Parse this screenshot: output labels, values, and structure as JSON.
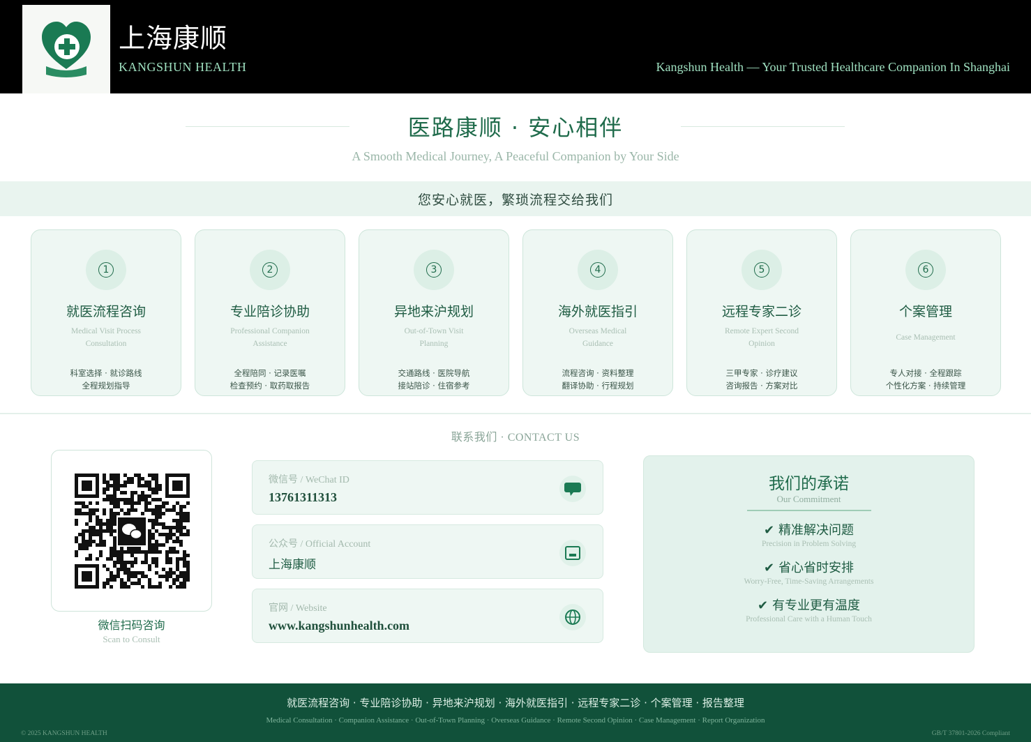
{
  "header": {
    "brand_cn": "上海康顺",
    "brand_en": "KANGSHUN HEALTH",
    "tagline": "Kangshun Health — Your Trusted Healthcare Companion In Shanghai"
  },
  "hero": {
    "title": "医路康顺 · 安心相伴",
    "subtitle": "A Smooth Medical Journey, A Peaceful Companion by Your Side"
  },
  "banner": "您安心就医，繁琐流程交给我们",
  "services": [
    {
      "num": "1",
      "title": "就医流程咨询",
      "en_1": "Medical Visit Process",
      "en_2": "Consultation",
      "desc_1": "科室选择 · 就诊路线",
      "desc_2": "全程规划指导"
    },
    {
      "num": "2",
      "title": "专业陪诊协助",
      "en_1": "Professional Companion",
      "en_2": "Assistance",
      "desc_1": "全程陪同 · 记录医嘱",
      "desc_2": "检查预约 · 取药取报告"
    },
    {
      "num": "3",
      "title": "异地来沪规划",
      "en_1": "Out-of-Town Visit",
      "en_2": "Planning",
      "desc_1": "交通路线 · 医院导航",
      "desc_2": "接站陪诊 · 住宿参考"
    },
    {
      "num": "4",
      "title": "海外就医指引",
      "en_1": "Overseas Medical",
      "en_2": "Guidance",
      "desc_1": "流程咨询 · 资料整理",
      "desc_2": "翻译协助 · 行程规划"
    },
    {
      "num": "5",
      "title": "远程专家二诊",
      "en_1": "Remote Expert Second",
      "en_2": "Opinion",
      "desc_1": "三甲专家 · 诊疗建议",
      "desc_2": "咨询报告 · 方案对比"
    },
    {
      "num": "6",
      "title": "个案管理",
      "en_1": "Case Management",
      "en_2": "",
      "desc_1": "专人对接 · 全程跟踪",
      "desc_2": "个性化方案 · 持续管理"
    }
  ],
  "contact": {
    "title": "联系我们 · CONTACT US",
    "qr_label": "微信扫码咨询",
    "qr_sub": "Scan to Consult",
    "wechat_label": "微信号 / WeChat ID",
    "wechat_value": "13761311313",
    "account_label": "公众号 / Official Account",
    "account_value": "上海康顺",
    "website_label": "官网 / Website",
    "website_value": "www.kangshunhealth.com"
  },
  "commitment": {
    "title": "我们的承诺",
    "subtitle": "Our Commitment",
    "items": [
      {
        "check": "✔",
        "cn": "精准解决问题",
        "en": "Precision in Problem Solving"
      },
      {
        "check": "✔",
        "cn": "省心省时安排",
        "en": "Worry-Free, Time-Saving Arrangements"
      },
      {
        "check": "✔",
        "cn": "有专业更有温度",
        "en": "Professional Care with a Human Touch"
      }
    ]
  },
  "footer": {
    "services_cn": "就医流程咨询 · 专业陪诊协助 · 异地来沪规划 · 海外就医指引 · 远程专家二诊 · 个案管理 · 报告整理",
    "services_en": "Medical Consultation · Companion Assistance · Out-of-Town Planning · Overseas Guidance · Remote Second Opinion · Case Management · Report Organization",
    "copyright": "© 2025 KANGSHUN HEALTH",
    "standard": "GB/T 37801-2026 Compliant"
  },
  "colors": {
    "primary": "#1f6b4b",
    "footer_bg": "#11513a",
    "header_bg": "#000000",
    "accent_text": "#9fe0c0"
  },
  "icons": {
    "logo": "heart-cross-logo-icon",
    "wechat": "chat-bubble-icon",
    "account": "tablet-icon",
    "website": "globe-icon"
  }
}
